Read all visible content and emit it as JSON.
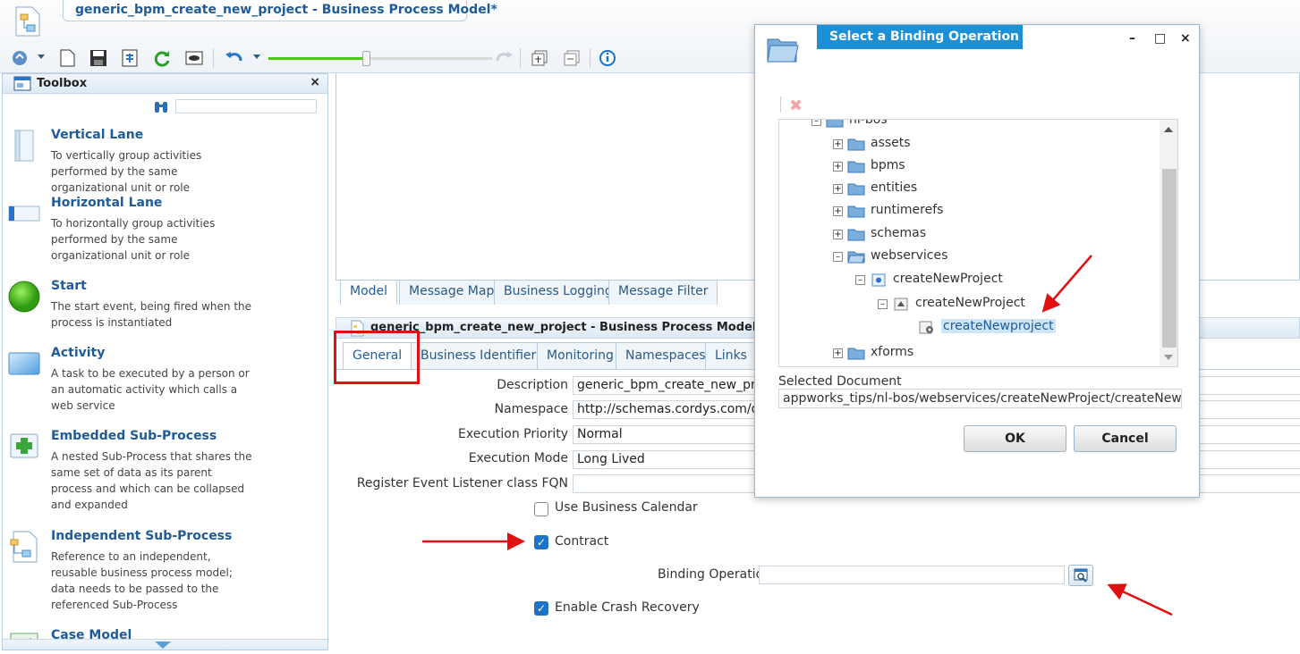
{
  "window": {
    "title": "generic_bpm_create_new_project - Business Process Model*"
  },
  "toolbox": {
    "title": "Toolbox",
    "close": "×",
    "search_placeholder": "",
    "items": [
      {
        "name": "Vertical Lane",
        "desc": "To vertically group activities performed by the same organizational unit or role",
        "icon": "vertical-lane-icon"
      },
      {
        "name": "Horizontal Lane",
        "desc": "To horizontally group activities performed by the same organizational unit or role",
        "icon": "horizontal-lane-icon"
      },
      {
        "name": "Start",
        "desc": "The start event, being fired when the process is instantiated",
        "icon": "start-event-icon"
      },
      {
        "name": "Activity",
        "desc": "A task to be executed by a person or an automatic activity which calls a web service",
        "icon": "activity-icon"
      },
      {
        "name": "Embedded Sub-Process",
        "desc": "A nested Sub-Process that shares the same set of data as its parent process and which can be collapsed and expanded",
        "icon": "embedded-subprocess-icon"
      },
      {
        "name": "Independent Sub-Process",
        "desc": "Reference to an independent, reusable business process model; data needs to be passed to the referenced Sub-Process",
        "icon": "independent-subprocess-icon"
      },
      {
        "name": "Case Model",
        "desc": "",
        "icon": "case-model-icon"
      }
    ]
  },
  "model_tabs": [
    "Model",
    "Message Map",
    "Business Logging",
    "Message Filter"
  ],
  "properties": {
    "header": "generic_bpm_create_new_project - Business Process Model*",
    "tabs": [
      "General",
      "Business Identifiers",
      "Monitoring",
      "Namespaces",
      "Links"
    ],
    "fields": {
      "description": {
        "label": "Description",
        "value": "generic_bpm_create_new_project"
      },
      "namespace": {
        "label": "Namespace",
        "value": "http://schemas.cordys.com/default"
      },
      "priority": {
        "label": "Execution Priority",
        "value": "Normal"
      },
      "mode": {
        "label": "Execution Mode",
        "value": "Long Lived"
      },
      "listener": {
        "label": "Register Event Listener class FQN",
        "value": ""
      }
    },
    "use_business_calendar": "Use Business Calendar",
    "contract": "Contract",
    "binding_operation": {
      "label": "Binding Operation",
      "value": ""
    },
    "crash_recovery": "Enable Crash Recovery"
  },
  "dialog": {
    "title": "Select a Binding Operation",
    "minimize": "–",
    "maximize": "□",
    "close": "×",
    "tree": [
      {
        "label": "nl-bos",
        "level": 0,
        "expander": "–"
      },
      {
        "label": "assets",
        "level": 1,
        "expander": "+"
      },
      {
        "label": "bpms",
        "level": 1,
        "expander": "+"
      },
      {
        "label": "entities",
        "level": 1,
        "expander": "+"
      },
      {
        "label": "runtimerefs",
        "level": 1,
        "expander": "+"
      },
      {
        "label": "schemas",
        "level": 1,
        "expander": "+"
      },
      {
        "label": "webservices",
        "level": 1,
        "expander": "–"
      },
      {
        "label": "createNewProject",
        "level": 2,
        "expander": "–"
      },
      {
        "label": "createNewProject",
        "level": 3,
        "expander": "–"
      },
      {
        "label": "createNewproject",
        "level": 4,
        "expander": ""
      },
      {
        "label": "xforms",
        "level": 1,
        "expander": "+"
      }
    ],
    "selected_label": "Selected Document",
    "selected_value": "appworks_tips/nl-bos/webservices/createNewProject/createNewProje...",
    "ok": "OK",
    "cancel": "Cancel"
  }
}
